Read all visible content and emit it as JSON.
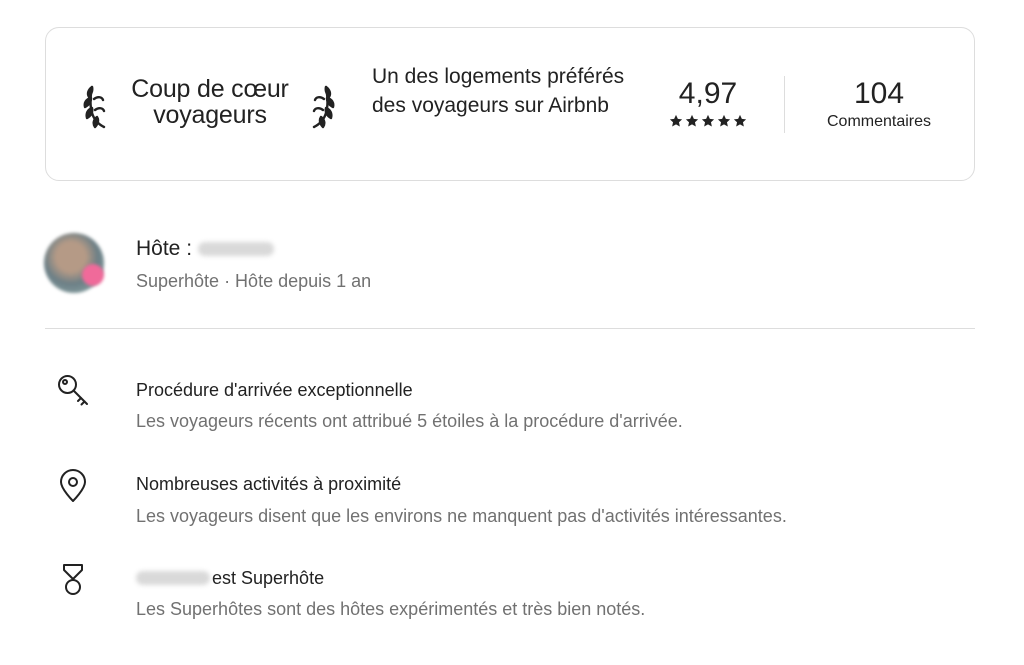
{
  "guest_favorite": {
    "badge_title": "Coup de cœur voyageurs",
    "description": "Un des logements préférés des voyageurs sur Airbnb",
    "rating": "4,97",
    "stars": 5,
    "reviews_count": "104",
    "reviews_label": "Commentaires",
    "icons": {
      "left": "laurel-left-icon",
      "right": "laurel-right-icon",
      "star": "star-icon"
    }
  },
  "host": {
    "label": "Hôte :",
    "subtitle": "Superhôte · Hôte depuis 1 an"
  },
  "highlights": [
    {
      "icon": "key-icon",
      "title": "Procédure d'arrivée exceptionnelle",
      "description": "Les voyageurs récents ont attribué 5 étoiles à la procédure d'arrivée."
    },
    {
      "icon": "location-pin-icon",
      "title": "Nombreuses activités à proximité",
      "description": "Les voyageurs disent que les environs ne manquent pas d'activités intéressantes."
    },
    {
      "icon": "superhost-medal-icon",
      "title": "est Superhôte",
      "description": "Les Superhôtes sont des hôtes expérimentés et très bien notés."
    }
  ],
  "colors": {
    "text_primary": "#222222",
    "text_secondary": "#717171",
    "border": "#dddddd"
  }
}
